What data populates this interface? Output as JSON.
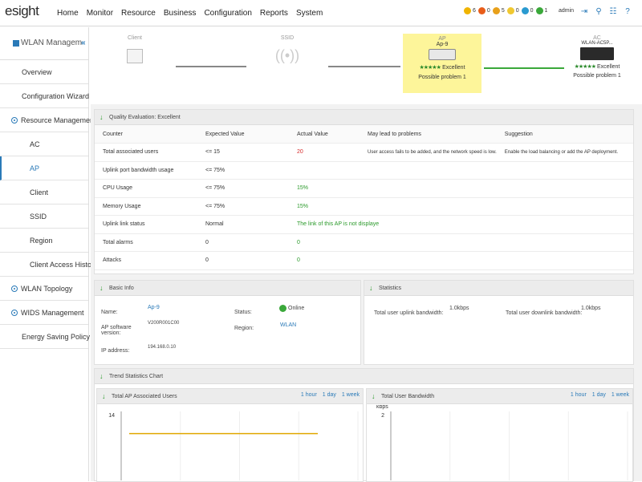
{
  "app": {
    "logo": "esight"
  },
  "nav": {
    "items": [
      "Home",
      "Monitor",
      "Resource",
      "Business",
      "Configuration",
      "Reports",
      "System"
    ]
  },
  "alerts": [
    {
      "count": "6",
      "color": "#f0b400"
    },
    {
      "count": "0",
      "color": "#e85d1a"
    },
    {
      "count": "5",
      "color": "#e8a01a"
    },
    {
      "count": "0",
      "color": "#f0c830"
    },
    {
      "count": "0",
      "color": "#2a9ad0"
    },
    {
      "count": "1",
      "color": "#3aa83a"
    }
  ],
  "user": {
    "name": "admin"
  },
  "sidebar": {
    "title": "WLAN Manageme",
    "items": [
      {
        "label": "Overview"
      },
      {
        "label": "Configuration Wizard"
      },
      {
        "label": "Resource Management"
      },
      {
        "label": "AC"
      },
      {
        "label": "AP"
      },
      {
        "label": "Client"
      },
      {
        "label": "SSID"
      },
      {
        "label": "Region"
      },
      {
        "label": "Client Access History"
      },
      {
        "label": "WLAN Topology"
      },
      {
        "label": "WIDS Management"
      },
      {
        "label": "Energy Saving Policy"
      }
    ]
  },
  "path": {
    "client": {
      "label": "Client"
    },
    "ssid": {
      "label": "SSID"
    },
    "ap": {
      "type": "AP",
      "name": "Ap-9",
      "rating": "Excellent",
      "stars": "★★★★★",
      "problem": "Possible problem 1"
    },
    "ac": {
      "type": "AC",
      "name": "WLAN-AC5P...",
      "rating": "Excellent",
      "stars": "★★★★★",
      "problem": "Possible problem 1"
    }
  },
  "quality": {
    "title": "Quality Evaluation: Excellent",
    "headers": [
      "Counter",
      "Expected Value",
      "Actual Value",
      "May lead to problems",
      "Suggestion"
    ],
    "rows": [
      [
        "Total associated users",
        "<= 15",
        "20",
        "User access fails to be added, and the network speed is low.",
        "Enable the load balancing or add the AP deployment."
      ],
      [
        "Uplink port bandwidth usage",
        "<= 75%",
        "",
        "",
        ""
      ],
      [
        "CPU Usage",
        "<= 75%",
        "15%",
        "",
        ""
      ],
      [
        "Memory Usage",
        "<= 75%",
        "15%",
        "",
        ""
      ],
      [
        "Uplink link status",
        "Normal",
        "The link of this AP is not displaye",
        "",
        ""
      ],
      [
        "Total alarms",
        "0",
        "0",
        "",
        ""
      ],
      [
        "Attacks",
        "0",
        "0",
        "",
        ""
      ]
    ]
  },
  "basic": {
    "title": "Basic Info",
    "name_label": "Name:",
    "name_value": "Ap-9",
    "sw_label": "AP software version:",
    "sw_value": "V200R001C00",
    "ip_label": "IP address:",
    "ip_value": "194.168.0.10",
    "status_label": "Status:",
    "status_value": "Online",
    "region_label": "Region:",
    "region_value": "WLAN"
  },
  "stats": {
    "title": "Statistics",
    "up_label": "Total user uplink bandwidth:",
    "up_value": "1.0kbps",
    "down_label": "Total user downlink bandwidth:",
    "down_value": "1.0kbps"
  },
  "trend": {
    "title": "Trend Statistics Chart",
    "left": {
      "title": "Total AP Associated Users",
      "ranges": [
        "1 hour",
        "1 day",
        "1 week"
      ],
      "ytick": "14"
    },
    "right": {
      "title": "Total User Bandwidth",
      "ranges": [
        "1 hour",
        "1 day",
        "1 week"
      ],
      "ylabel": "kbps",
      "ytick": "2"
    }
  },
  "chart_data": [
    {
      "type": "line",
      "title": "Total AP Associated Users",
      "ylim": [
        0,
        14
      ],
      "series": [
        {
          "values": [
            9.5,
            9.5,
            9.5,
            9.5,
            9.5,
            9.5
          ]
        }
      ],
      "color": "#e0a800"
    },
    {
      "type": "line",
      "title": "Total User Bandwidth",
      "ylabel": "kbps",
      "ylim": [
        0,
        2
      ],
      "series": []
    }
  ]
}
